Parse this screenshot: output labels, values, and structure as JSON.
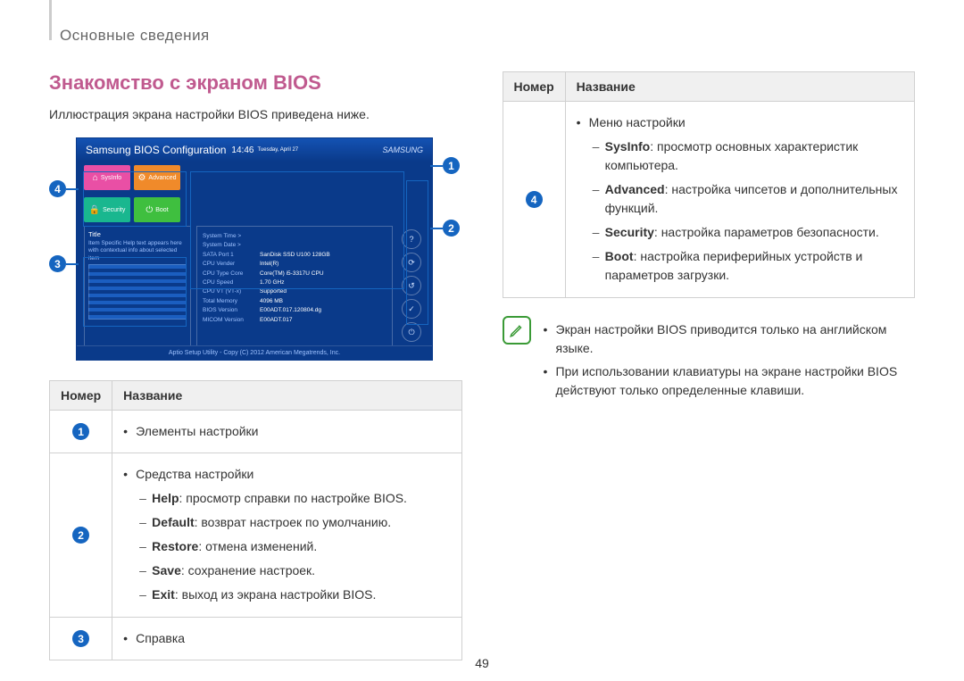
{
  "header": {
    "section": "Основные сведения"
  },
  "heading": "Знакомство с экраном BIOS",
  "intro": "Иллюстрация экрана настройки BIOS приведена ниже.",
  "callouts": {
    "c1": "1",
    "c2": "2",
    "c3": "3",
    "c4": "4"
  },
  "bios": {
    "title": "Samsung BIOS Configuration",
    "time": "14:46",
    "day": "Tuesday, April 27",
    "logo": "SAMSUNG",
    "tiles": {
      "sysinfo": "SysInfo",
      "advanced": "Advanced",
      "security": "Security",
      "boot": "Boot"
    },
    "info": [
      {
        "k": "System Time >",
        "v": ""
      },
      {
        "k": "System Date >",
        "v": ""
      },
      {
        "k": "SATA Port 1",
        "v": "SanDisk SSD U100 128GB"
      },
      {
        "k": "CPU Vender",
        "v": "Intel(R)"
      },
      {
        "k": "CPU Type Core",
        "v": "Core(TM) i5-3317U CPU"
      },
      {
        "k": "CPU Speed",
        "v": "1.70 GHz"
      },
      {
        "k": "CPU VT (VT-x)",
        "v": "Supported"
      },
      {
        "k": "Total Memory",
        "v": "4096 MB"
      },
      {
        "k": "BIOS Version",
        "v": "E00ADT.017.120804.dg"
      },
      {
        "k": "MICOM Version",
        "v": "E00ADT.017"
      }
    ],
    "side": {
      "help": "?",
      "default": "⟳",
      "restore": "↺",
      "save": "✓",
      "exit": "⏻"
    },
    "helpbox": {
      "title": "Title",
      "body": "Item Specific Help text appears here with contextual info about selected item"
    },
    "footer": "Aptio Setup Utility - Copy (C) 2012 American Megatrends, Inc."
  },
  "table_headers": {
    "num": "Номер",
    "name": "Название"
  },
  "left_rows": {
    "r1": {
      "num": "1",
      "text": "Элементы настройки"
    },
    "r2": {
      "num": "2",
      "text": "Средства настройки",
      "subs": [
        {
          "b": "Help",
          "t": ": просмотр справки по настройке BIOS."
        },
        {
          "b": "Default",
          "t": ": возврат настроек по умолчанию."
        },
        {
          "b": "Restore",
          "t": ": отмена изменений."
        },
        {
          "b": "Save",
          "t": ": сохранение настроек."
        },
        {
          "b": "Exit",
          "t": ": выход из экрана настройки BIOS."
        }
      ]
    },
    "r3": {
      "num": "3",
      "text": "Справка"
    }
  },
  "right_rows": {
    "r4": {
      "num": "4",
      "text": "Меню настройки",
      "subs": [
        {
          "b": "SysInfo",
          "t": ": просмотр основных характеристик компьютера."
        },
        {
          "b": "Advanced",
          "t": ": настройка чипсетов и дополнительных функций."
        },
        {
          "b": "Security",
          "t": ": настройка параметров безопасности."
        },
        {
          "b": "Boot",
          "t": ": настройка периферийных устройств и параметров загрузки."
        }
      ]
    }
  },
  "note": {
    "bullet1": "Экран настройки BIOS приводится только на английском языке.",
    "bullet2": "При использовании клавиатуры на экране настройки BIOS действуют только определенные клавиши."
  },
  "pagenum": "49"
}
